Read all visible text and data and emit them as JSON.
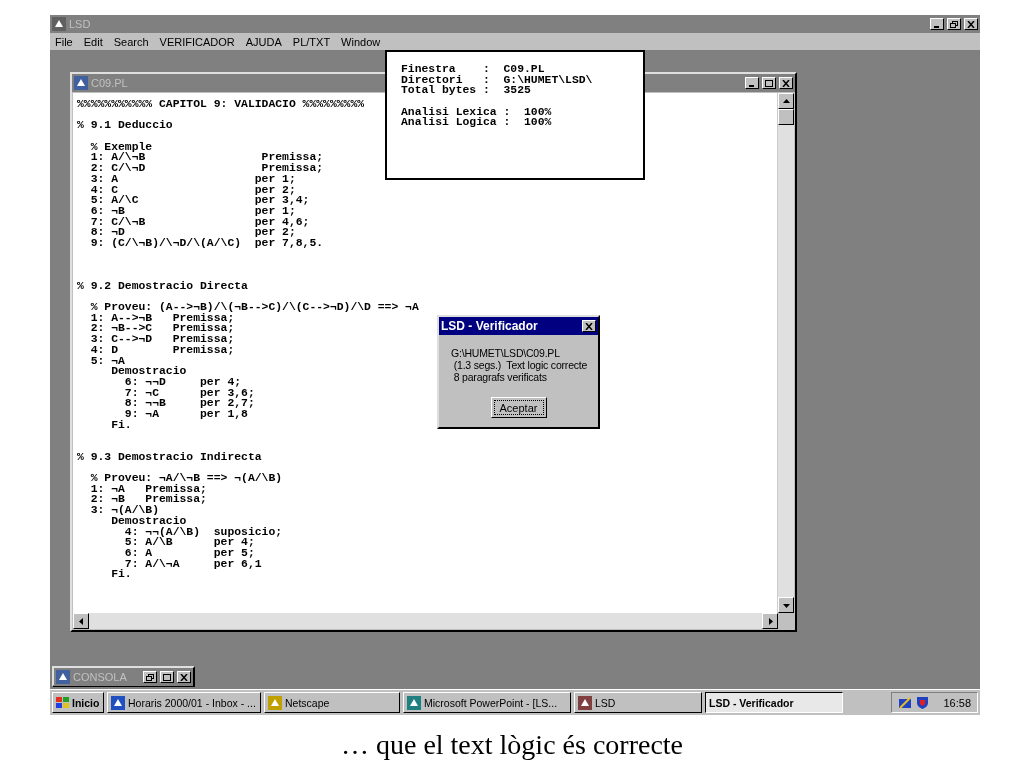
{
  "window": {
    "title": "LSD",
    "active": false
  },
  "menu": [
    {
      "label": "File"
    },
    {
      "label": "Edit"
    },
    {
      "label": "Search"
    },
    {
      "label": "VERIFICADOR"
    },
    {
      "label": "AJUDA"
    },
    {
      "label": "PL/TXT"
    },
    {
      "label": "Window"
    }
  ],
  "editor": {
    "title": "C09.PL",
    "active": false,
    "lines": [
      {
        "kind": "code",
        "text": "%%%%%%%%%%% CAPITOL 9: VALIDACIO %%%%%%%%%"
      },
      {
        "kind": "blank"
      },
      {
        "kind": "code",
        "text": "% 9.1 Deduccio"
      },
      {
        "kind": "blank"
      },
      {
        "kind": "code",
        "text": "  % Exemple"
      },
      {
        "kind": "code",
        "text": "  1: A/\\¬B                 Premissa;"
      },
      {
        "kind": "code",
        "text": "  2: C/\\¬D                 Premissa;"
      },
      {
        "kind": "code",
        "text": "  3: A                    per 1;"
      },
      {
        "kind": "code",
        "text": "  4: C                    per 2;"
      },
      {
        "kind": "code",
        "text": "  5: A/\\C                 per 3,4;"
      },
      {
        "kind": "code",
        "text": "  6: ¬B                   per 1;"
      },
      {
        "kind": "code",
        "text": "  7: C/\\¬B                per 4,6;"
      },
      {
        "kind": "code",
        "text": "  8: ¬D                   per 2;"
      },
      {
        "kind": "code",
        "text": "  9: (C/\\¬B)/\\¬D/\\(A/\\C)  per 7,8,5."
      },
      {
        "kind": "blank"
      },
      {
        "kind": "blank"
      },
      {
        "kind": "blank"
      },
      {
        "kind": "code",
        "text": "% 9.2 Demostracio Directa"
      },
      {
        "kind": "blank"
      },
      {
        "kind": "code",
        "text": "  % Proveu: (A-->¬B)/\\(¬B-->C)/\\(C-->¬D)/\\D ==> ¬A"
      },
      {
        "kind": "code",
        "text": "  1: A-->¬B   Premissa;"
      },
      {
        "kind": "code",
        "text": "  2: ¬B-->C   Premissa;"
      },
      {
        "kind": "code",
        "text": "  3: C-->¬D   Premissa;"
      },
      {
        "kind": "code",
        "text": "  4: D        Premissa;"
      },
      {
        "kind": "code",
        "text": "  5: ¬A"
      },
      {
        "kind": "code",
        "text": "     Demostracio"
      },
      {
        "kind": "code",
        "text": "       6: ¬¬D     per 4;"
      },
      {
        "kind": "code",
        "text": "       7: ¬C      per 3,6;"
      },
      {
        "kind": "code",
        "text": "       8: ¬¬B     per 2,7;"
      },
      {
        "kind": "code",
        "text": "       9: ¬A      per 1,8"
      },
      {
        "kind": "code",
        "text": "     Fi."
      },
      {
        "kind": "blank"
      },
      {
        "kind": "blank"
      },
      {
        "kind": "code",
        "text": "% 9.3 Demostracio Indirecta"
      },
      {
        "kind": "blank"
      },
      {
        "kind": "code",
        "text": "  % Proveu: ¬A/\\¬B ==> ¬(A/\\B)"
      },
      {
        "kind": "code",
        "text": "  1: ¬A   Premissa;"
      },
      {
        "kind": "code",
        "text": "  2: ¬B   Premissa;"
      },
      {
        "kind": "code",
        "text": "  3: ¬(A/\\B)"
      },
      {
        "kind": "code",
        "text": "     Demostracio"
      },
      {
        "kind": "code",
        "text": "       4: ¬¬(A/\\B)  suposicio;"
      },
      {
        "kind": "code",
        "text": "       5: A/\\B      per 4;"
      },
      {
        "kind": "code",
        "text": "       6: A         per 5;"
      },
      {
        "kind": "code",
        "text": "       7: A/\\¬A     per 6,1"
      },
      {
        "kind": "code",
        "text": "     Fi."
      }
    ]
  },
  "info_panel": {
    "lines": [
      {
        "kind": "code",
        "text": "Finestra    :  C09.PL"
      },
      {
        "kind": "code",
        "text": "Directori   :  G:\\HUMET\\LSD\\"
      },
      {
        "kind": "code",
        "text": "Total bytes :  3525"
      },
      {
        "kind": "blank"
      },
      {
        "kind": "code",
        "text": "Analisi Lexica :  100%"
      },
      {
        "kind": "code",
        "text": "Analisi Logica :  100%"
      }
    ]
  },
  "dialog": {
    "title": "LSD - Verificador",
    "active": true,
    "message": [
      "G:\\HUMET\\LSD\\C09.PL",
      " (1.3 segs.)  Text logic correcte",
      " 8 paragrafs verificats"
    ],
    "button": "Aceptar"
  },
  "console": {
    "title": "CONSOLA"
  },
  "taskbar": {
    "start": "Inicio",
    "tasks": [
      {
        "label": "Horaris 2000/01 - Inbox - ...",
        "selected": false,
        "color": "#2050c0"
      },
      {
        "label": "Netscape",
        "selected": false,
        "color": "#c0a000"
      },
      {
        "label": "Microsoft PowerPoint - [LS...",
        "selected": false,
        "color": "#208080"
      },
      {
        "label": "LSD",
        "selected": false,
        "color": "#804040"
      },
      {
        "label": "LSD - Verificador",
        "selected": true
      }
    ],
    "clock": "16:58"
  },
  "caption": "… que el text lògic és correcte"
}
